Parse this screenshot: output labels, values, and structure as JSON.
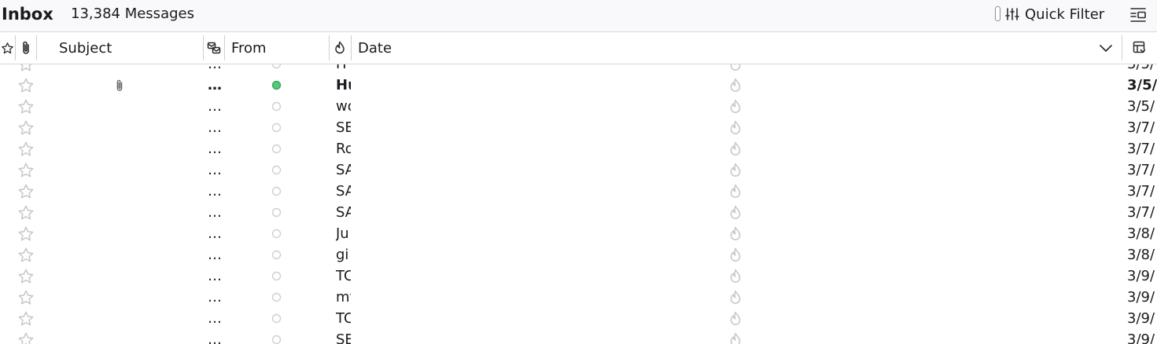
{
  "folder": {
    "name": "Inbox",
    "count": "13,384 Messages"
  },
  "toolbar": {
    "quick_filter_label": "Quick Filter",
    "quick_filter_icon": "sliders-icon",
    "layout_icon": "list-layout-icon"
  },
  "columns": {
    "star_icon": "star-icon",
    "attachment_icon": "paperclip-icon",
    "subject": "Subject",
    "thread_icon": "thread-icon",
    "from": "From",
    "junk_icon": "junk-icon",
    "date": "Date",
    "sort_icon": "chevron-down-icon",
    "column_picker_icon": "column-picker-icon"
  },
  "colors": {
    "unread_dot": "#57c87a",
    "read_dot": "#d0d0d4",
    "icon_gray": "#c8c8cc"
  },
  "messages": [
    {
      "subject": "…",
      "from": "H",
      "date": "3/5/",
      "unread": false,
      "attachment": false,
      "partial": true
    },
    {
      "subject": "…",
      "from": "Hu",
      "date": "3/5/",
      "unread": true,
      "attachment": true
    },
    {
      "subject": "…",
      "from": "wo",
      "date": "3/5/",
      "unread": false,
      "attachment": false
    },
    {
      "subject": "…",
      "from": "SE",
      "date": "3/7/",
      "unread": false,
      "attachment": false
    },
    {
      "subject": "…",
      "from": "Ro",
      "date": "3/7/",
      "unread": false,
      "attachment": false
    },
    {
      "subject": "…",
      "from": "SA",
      "date": "3/7/",
      "unread": false,
      "attachment": false
    },
    {
      "subject": "…",
      "from": "SA",
      "date": "3/7/",
      "unread": false,
      "attachment": false
    },
    {
      "subject": "…",
      "from": "SA",
      "date": "3/7/",
      "unread": false,
      "attachment": false
    },
    {
      "subject": "…",
      "from": "Ju",
      "date": "3/8/",
      "unread": false,
      "attachment": false
    },
    {
      "subject": "…",
      "from": "gi",
      "date": "3/8/",
      "unread": false,
      "attachment": false
    },
    {
      "subject": "…",
      "from": "TC",
      "date": "3/9/",
      "unread": false,
      "attachment": false
    },
    {
      "subject": "…",
      "from": "my",
      "date": "3/9/",
      "unread": false,
      "attachment": false
    },
    {
      "subject": "…",
      "from": "TC",
      "date": "3/9/",
      "unread": false,
      "attachment": false
    },
    {
      "subject": "…",
      "from": "SE",
      "date": "3/9/",
      "unread": false,
      "attachment": false
    }
  ]
}
